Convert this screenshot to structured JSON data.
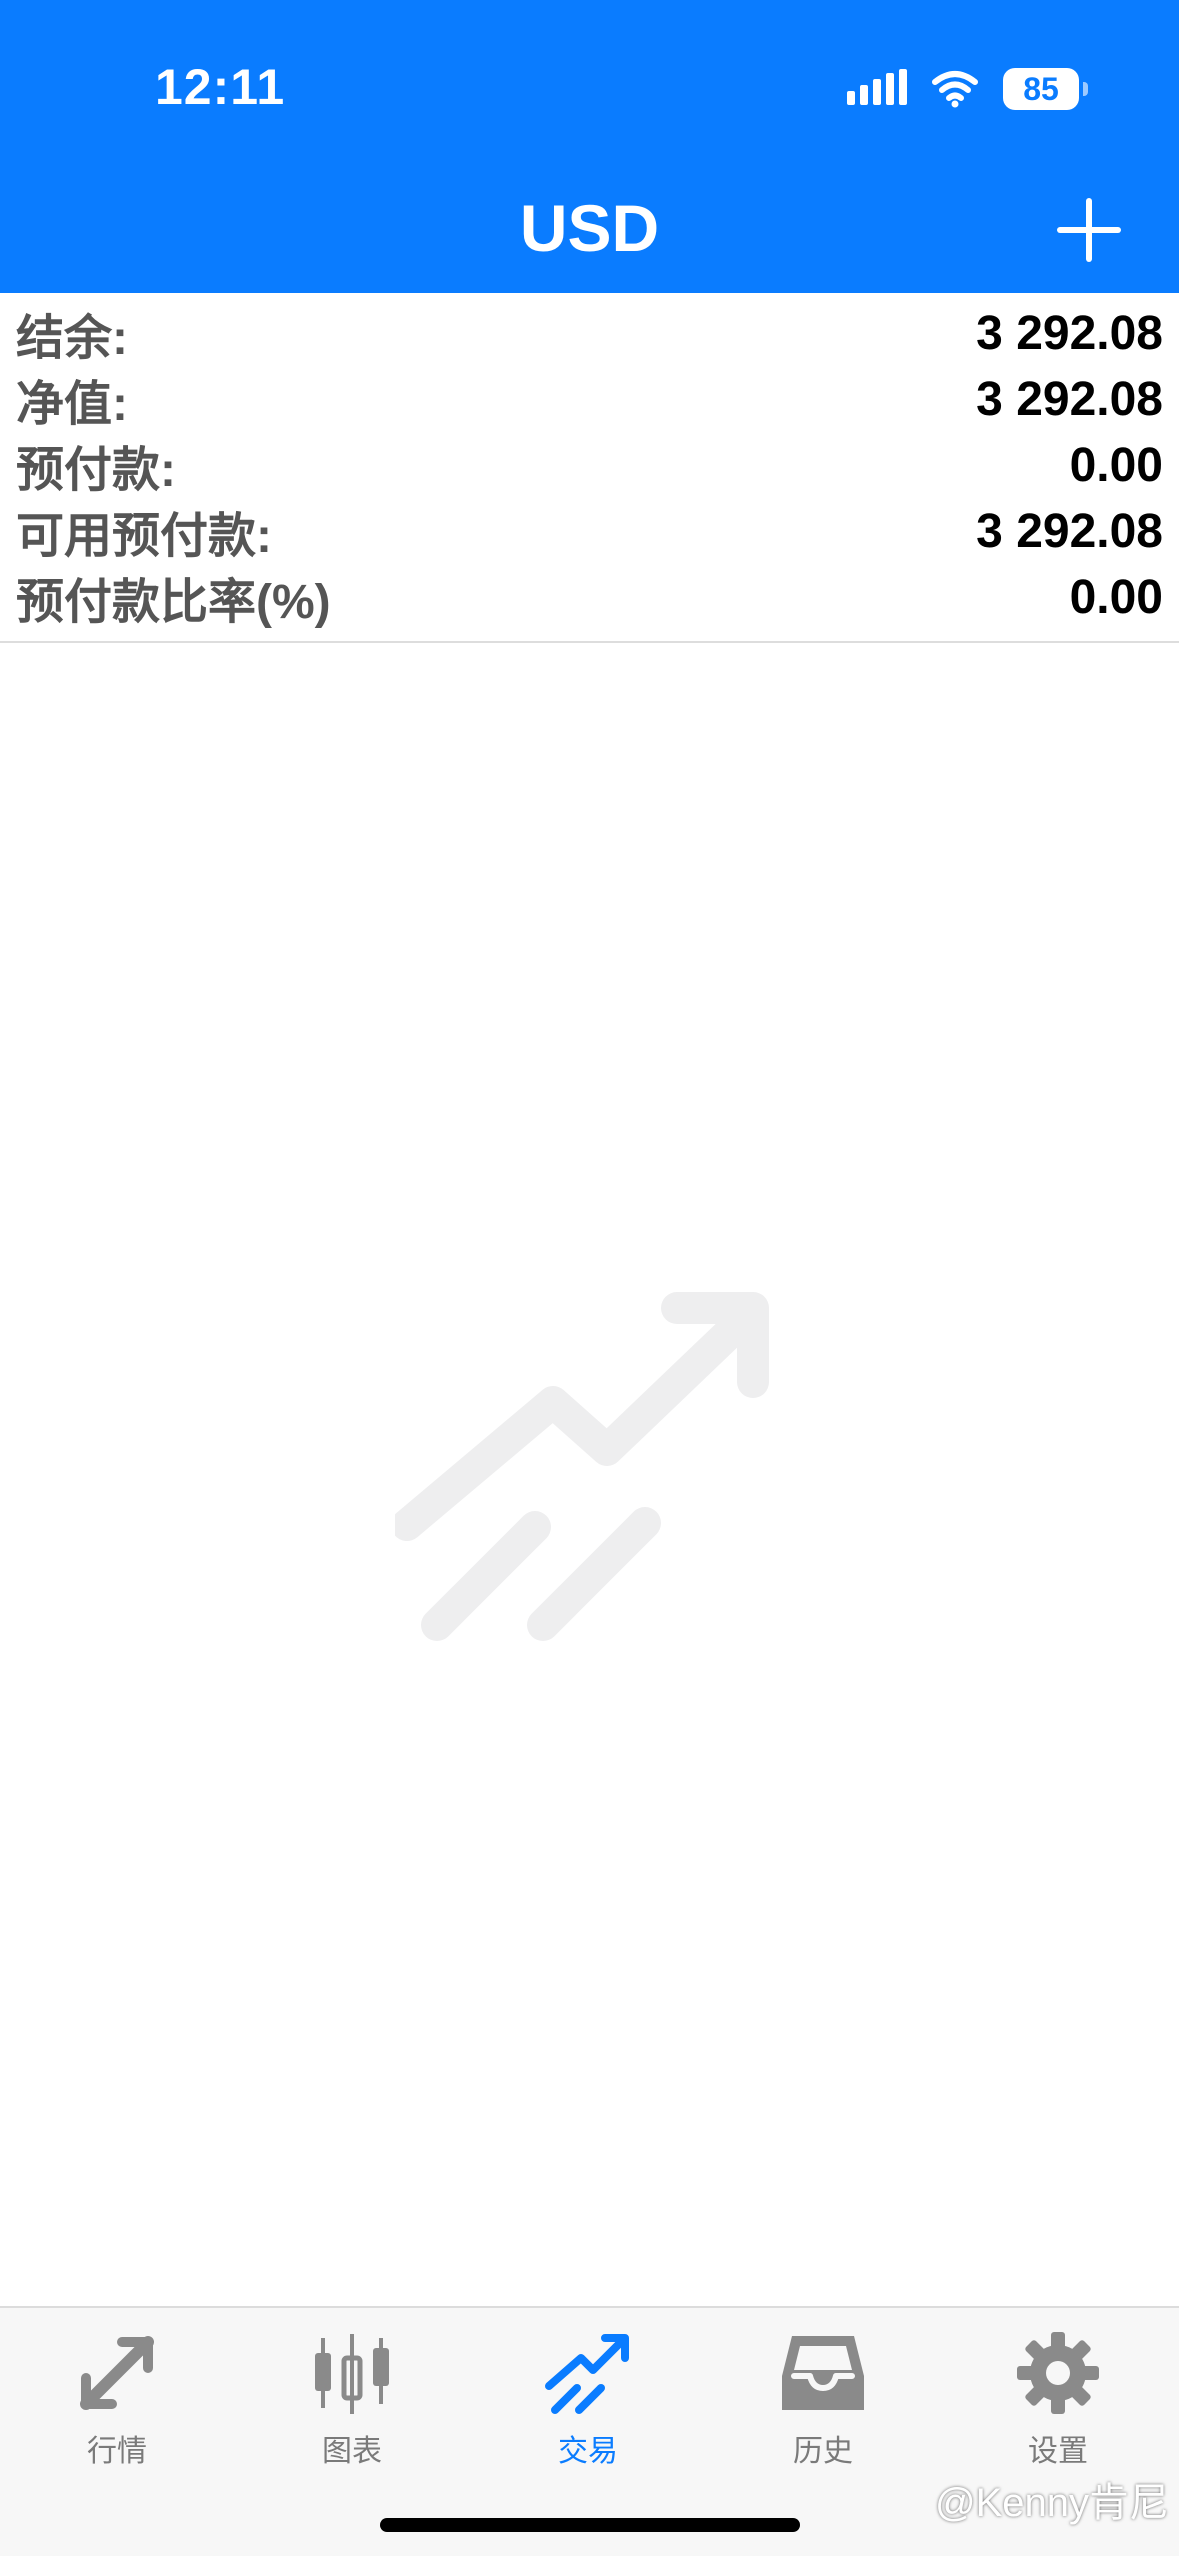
{
  "status_bar": {
    "time": "12:11",
    "battery": "85"
  },
  "header": {
    "title": "USD",
    "add_icon": "plus-icon"
  },
  "account": {
    "rows": [
      {
        "label": "结余:",
        "value": "3 292.08"
      },
      {
        "label": "净值:",
        "value": "3 292.08"
      },
      {
        "label": "预付款:",
        "value": "0.00"
      },
      {
        "label": "可用预付款:",
        "value": "3 292.08"
      },
      {
        "label": "预付款比率(%)",
        "value": "0.00"
      }
    ]
  },
  "empty_state_icon": "trade-trend-icon",
  "tabbar": {
    "tabs": [
      {
        "label": "行情",
        "icon": "quotes-icon"
      },
      {
        "label": "图表",
        "icon": "candlestick-icon"
      },
      {
        "label": "交易",
        "icon": "trade-icon"
      },
      {
        "label": "历史",
        "icon": "inbox-icon"
      },
      {
        "label": "设置",
        "icon": "gear-icon"
      }
    ],
    "active_index": 2
  },
  "watermark": "@Kenny肯尼",
  "colors": {
    "accent": "#0a7cff",
    "tab_inactive": "#7a7a7a",
    "empty_icon": "#eeeeef"
  }
}
